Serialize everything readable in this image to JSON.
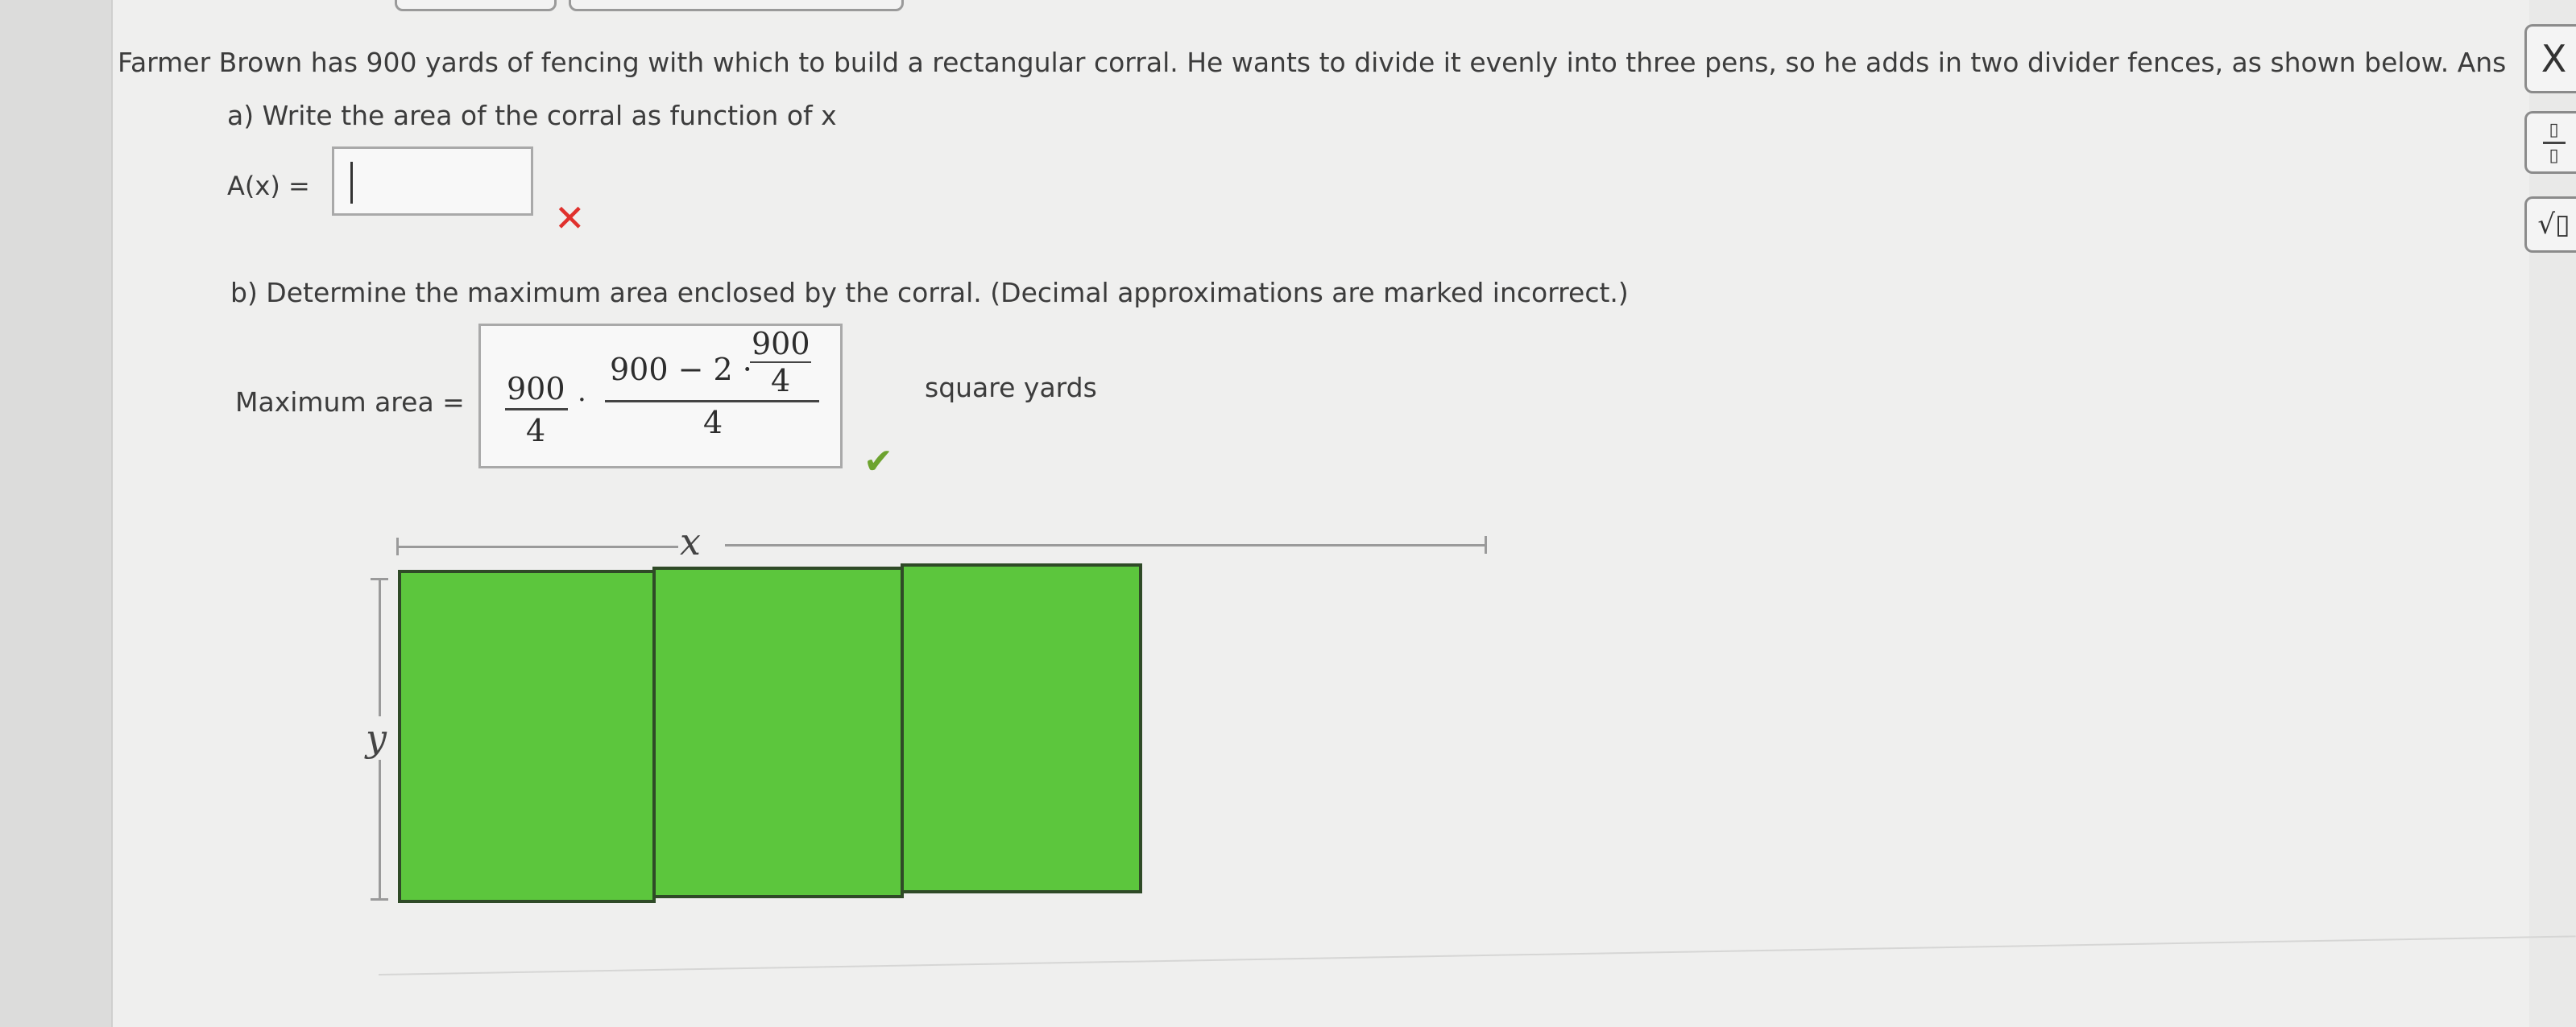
{
  "problem": {
    "statement": "Farmer Brown has 900 yards of fencing with which to build a rectangular corral. He wants to divide it evenly into three pens, so he adds in two divider fences, as shown below. Ans"
  },
  "part_a": {
    "prompt": "a) Write the area of the corral as function of x",
    "answer_label": "A(x) =",
    "answer_value": "",
    "status_icon": "red-x-mark"
  },
  "part_b": {
    "prompt": "b) Determine the maximum area enclosed by the corral. (Decimal approximations are marked incorrect.)",
    "answer_label": "Maximum area =",
    "answer": {
      "left_numerator": "900",
      "left_denominator": "4",
      "dot": "·",
      "right_numerator_main": "900 − 2 ·",
      "right_inner_numerator": "900",
      "right_inner_denominator": "4",
      "right_denominator": "4"
    },
    "units": "square yards",
    "status_icon": "green-check-mark"
  },
  "diagram": {
    "x_label": "x",
    "y_label": "y",
    "pens": 3,
    "fence_color": "#5cc63d"
  },
  "toolbar": {
    "close_label": "X",
    "fraction_top": "▯",
    "fraction_bottom": "▯",
    "sqrt_label": "√▯"
  }
}
